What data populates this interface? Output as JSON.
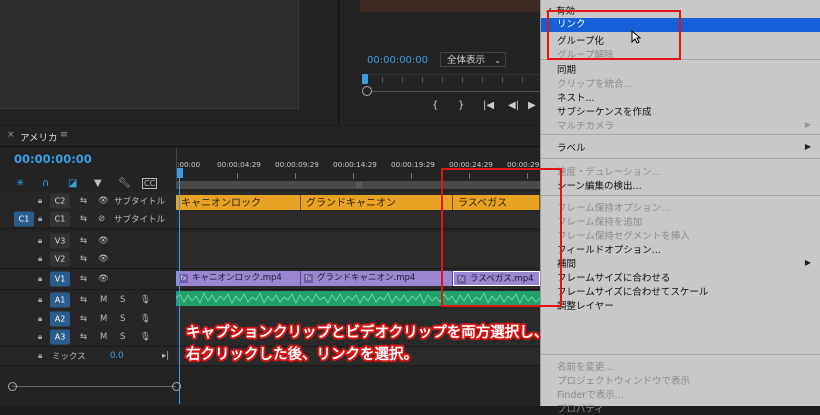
{
  "program_monitor": {
    "timecode": "00:00:00:00",
    "fit_label": "全体表示"
  },
  "timeline": {
    "sequence_name": "アメリカ",
    "timecode": "00:00:00:00",
    "ruler_labels": [
      ":00:00",
      "00:00:04:29",
      "00:00:09:29",
      "00:00:14:29",
      "00:00:19:29",
      "00:00:24:29",
      "00:00:29:2"
    ],
    "tracks": {
      "c2": {
        "target": "",
        "label": "C2",
        "name": "サブタイトル"
      },
      "c1": {
        "target": "C1",
        "label": "C1",
        "name": "サブタイトル"
      },
      "v3": {
        "label": "V3"
      },
      "v2": {
        "label": "V2"
      },
      "v1": {
        "label": "V1"
      },
      "a1": {
        "label": "A1",
        "m": "M",
        "s": "S"
      },
      "a2": {
        "label": "A2",
        "m": "M",
        "s": "S"
      },
      "a3": {
        "label": "A3",
        "m": "M",
        "s": "S"
      },
      "mix": {
        "name": "ミックス",
        "value": "0.0"
      }
    },
    "caption_clips": [
      "キャニオンロック",
      "グランドキャニオン",
      "ラスベガス"
    ],
    "video_clips": [
      "キャニオンロック.mp4",
      "グランドキャニオン.mp4",
      "ラスベガス.mp4"
    ]
  },
  "context_menu": {
    "items": [
      {
        "label": "✓ 有効",
        "state": "normal"
      },
      {
        "label": "リンク",
        "state": "selected"
      },
      {
        "label": "グループ化",
        "state": "normal"
      },
      {
        "label": "グループ解除",
        "state": "disabled"
      },
      {
        "label": "同期",
        "state": "normal"
      },
      {
        "label": "クリップを統合...",
        "state": "disabled"
      },
      {
        "label": "ネスト...",
        "state": "normal"
      },
      {
        "label": "サブシーケンスを作成",
        "state": "normal"
      },
      {
        "label": "マルチカメラ",
        "state": "disabled"
      },
      {
        "label": "ラベル",
        "state": "normal"
      },
      {
        "label": "速度・デュレーション...",
        "state": "disabled"
      },
      {
        "label": "シーン編集の検出...",
        "state": "normal"
      },
      {
        "label": "フレーム保持オプション...",
        "state": "disabled"
      },
      {
        "label": "フレーム保持を追加",
        "state": "disabled"
      },
      {
        "label": "フレーム保持セグメントを挿入",
        "state": "disabled"
      },
      {
        "label": "フィールドオプション...",
        "state": "normal"
      },
      {
        "label": "補間",
        "state": "normal"
      },
      {
        "label": "フレームサイズに合わせる",
        "state": "normal"
      },
      {
        "label": "フレームサイズに合わせてスケール",
        "state": "normal"
      },
      {
        "label": "調整レイヤー",
        "state": "normal"
      },
      {
        "label": "名前を変更...",
        "state": "disabled"
      },
      {
        "label": "プロジェクトウィンドウで表示",
        "state": "disabled"
      },
      {
        "label": "Finderで表示...",
        "state": "disabled"
      },
      {
        "label": "プロパティ",
        "state": "disabled"
      }
    ]
  },
  "instruction": {
    "line1": "キャプションクリップとビデオクリップを両方選択し、",
    "line2": "右クリックした後、リンクを選択。"
  },
  "colors": {
    "accent_blue": "#3aa0e6",
    "caption_clip": "#e8a224",
    "video_clip": "#9a87cf",
    "audio_clip": "#22a06b",
    "menu_selected": "#1560d6",
    "highlight": "#e11515"
  }
}
